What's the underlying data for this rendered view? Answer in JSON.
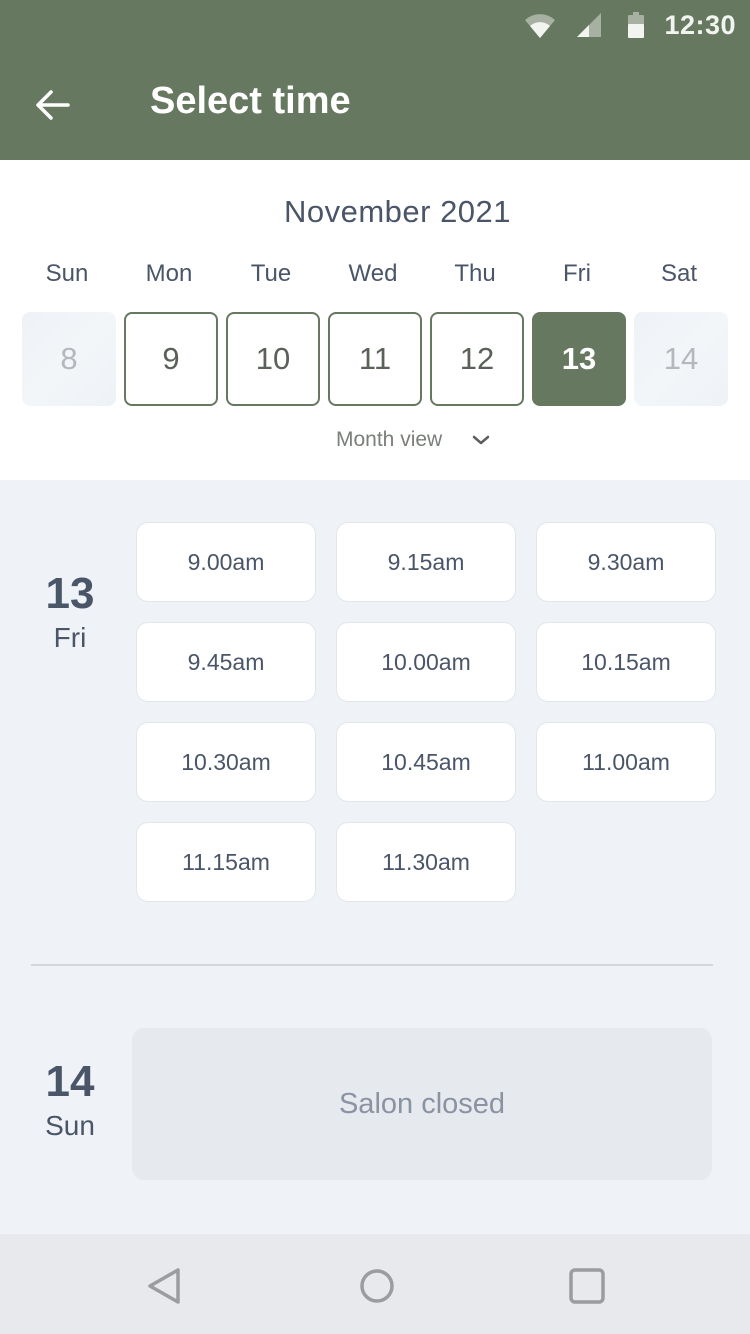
{
  "status_bar": {
    "time": "12:30",
    "icons": [
      "wifi-icon",
      "cellular-signal-icon",
      "battery-icon"
    ]
  },
  "app_bar": {
    "back_icon": "arrow-left-icon",
    "title": "Select time"
  },
  "calendar": {
    "month": "November 2021",
    "weekdays": [
      "Sun",
      "Mon",
      "Tue",
      "Wed",
      "Thu",
      "Fri",
      "Sat"
    ],
    "days": [
      {
        "label": "8",
        "state": "disabled"
      },
      {
        "label": "9",
        "state": "available"
      },
      {
        "label": "10",
        "state": "available"
      },
      {
        "label": "11",
        "state": "available"
      },
      {
        "label": "12",
        "state": "available"
      },
      {
        "label": "13",
        "state": "selected"
      },
      {
        "label": "14",
        "state": "disabled"
      }
    ],
    "month_view_label": "Month view",
    "month_view_icon": "chevron-down-icon"
  },
  "schedule": [
    {
      "day_number": "13",
      "day_name": "Fri",
      "slots": [
        "9.00am",
        "9.15am",
        "9.30am",
        "9.45am",
        "10.00am",
        "10.15am",
        "10.30am",
        "10.45am",
        "11.00am",
        "11.15am",
        "11.30am"
      ]
    },
    {
      "day_number": "14",
      "day_name": "Sun",
      "closed_message": "Salon closed"
    }
  ],
  "colors": {
    "brand": "#677860",
    "text": "#4a5568",
    "background": "#eff3f8"
  },
  "nav_bar": {
    "icons": [
      "nav-back-icon",
      "nav-home-icon",
      "nav-recents-icon"
    ]
  }
}
